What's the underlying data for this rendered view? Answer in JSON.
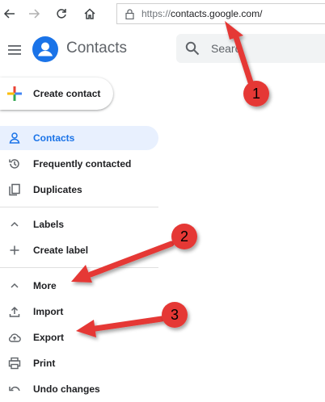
{
  "browser": {
    "url_protocol": "https://",
    "url_host": "contacts.google.com/"
  },
  "app": {
    "title": "Contacts",
    "search_placeholder": "Searc"
  },
  "create_contact_label": "Create contact",
  "nav": {
    "contacts": "Contacts",
    "frequently_contacted": "Frequently contacted",
    "duplicates": "Duplicates",
    "labels": "Labels",
    "create_label": "Create label",
    "more": "More",
    "import": "Import",
    "export": "Export",
    "print": "Print",
    "undo_changes": "Undo changes"
  },
  "annotations": {
    "badge_1": "1",
    "badge_2": "2",
    "badge_3": "3"
  },
  "colors": {
    "accent": "#1a73e8",
    "active_bg": "#e8f0fe",
    "annotation_red": "#e53935"
  }
}
